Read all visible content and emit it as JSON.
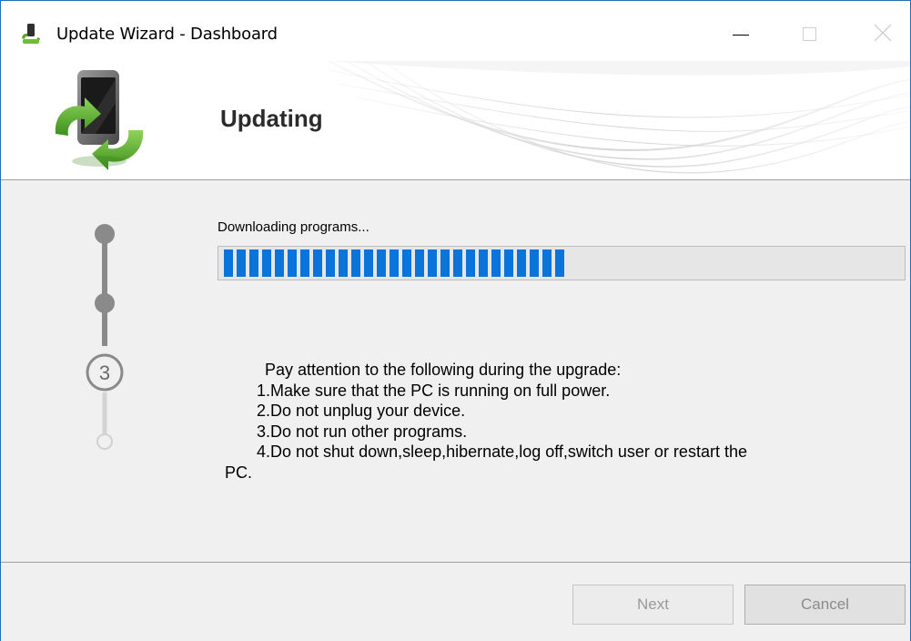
{
  "window": {
    "title": "Update Wizard - Dashboard",
    "accent": "#1e6fb8"
  },
  "header": {
    "title": "Updating"
  },
  "steps": {
    "current_label": "3",
    "total": 4,
    "current": 3
  },
  "progress": {
    "status": "Downloading programs...",
    "fraction": 0.52,
    "color": "#0a74da"
  },
  "notes": {
    "intro": "Pay attention to the following during the upgrade:",
    "items": [
      "1.Make sure that the PC is running on full power.",
      "2.Do not unplug your device.",
      "3.Do not run other programs.",
      "4.Do not shut down,sleep,hibernate,log off,switch user or restart the"
    ],
    "tail": "PC."
  },
  "buttons": {
    "next": "Next",
    "cancel": "Cancel"
  }
}
